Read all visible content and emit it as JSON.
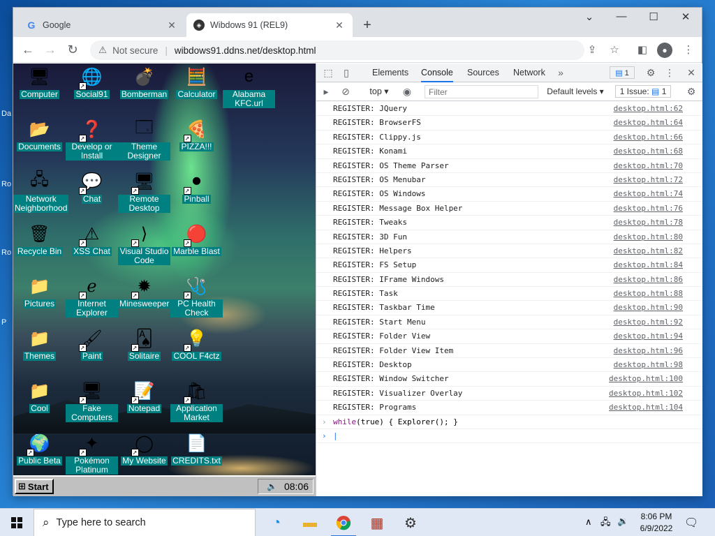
{
  "windows_bg": {
    "side_labels": [
      "Da",
      "Ro",
      "Ro",
      "P"
    ]
  },
  "browser": {
    "tabs": [
      {
        "title": "Google",
        "active": false,
        "favicon": "google-icon"
      },
      {
        "title": "Wibdows 91 (REL9)",
        "active": true,
        "favicon": "wibdows-icon"
      }
    ],
    "new_tab_symbol": "+",
    "window_controls": {
      "tab_search": "⌄",
      "minimize": "—",
      "maximize": "☐",
      "close": "✕"
    },
    "address": {
      "security_label": "Not secure",
      "url": "wibdows91.ddns.net/desktop.html"
    }
  },
  "desktop": {
    "icons": [
      {
        "label": "Computer",
        "glyph": "🖥"
      },
      {
        "label": "Social91",
        "glyph": "🌐",
        "shortcut": true
      },
      {
        "label": "Bomberman",
        "glyph": "💣"
      },
      {
        "label": "Calculator",
        "glyph": "🧮"
      },
      {
        "label": "Alabama KFC.url",
        "glyph": "e"
      },
      {
        "label": "Documents",
        "glyph": "📂"
      },
      {
        "label": "Develop or Install",
        "glyph": "❓",
        "shortcut": true
      },
      {
        "label": "Theme Designer",
        "glyph": "🗔"
      },
      {
        "label": "PIZZA!!!",
        "glyph": "🍕",
        "shortcut": true
      },
      {
        "label": "Network Neighborhood",
        "glyph": "🖧"
      },
      {
        "label": "Chat",
        "glyph": "💬",
        "shortcut": true
      },
      {
        "label": "Remote Desktop",
        "glyph": "🖥",
        "shortcut": true
      },
      {
        "label": "Pinball",
        "glyph": "⚫",
        "shortcut": true
      },
      {
        "label": "Recycle Bin",
        "glyph": "🗑"
      },
      {
        "label": "XSS Chat",
        "glyph": "⚠",
        "shortcut": true
      },
      {
        "label": "Visual Studio Code",
        "glyph": "⟩",
        "shortcut": true
      },
      {
        "label": "Marble Blast",
        "glyph": "🔴",
        "shortcut": true
      },
      {
        "label": "Pictures",
        "glyph": "📁"
      },
      {
        "label": "Internet Explorer",
        "glyph": "ℯ",
        "shortcut": true
      },
      {
        "label": "Minesweeper",
        "glyph": "✹",
        "shortcut": true
      },
      {
        "label": "PC Health Check",
        "glyph": "🩺",
        "shortcut": true
      },
      {
        "label": "Themes",
        "glyph": "📁"
      },
      {
        "label": "Paint",
        "glyph": "🖌",
        "shortcut": true
      },
      {
        "label": "Solitaire",
        "glyph": "🂡",
        "shortcut": true
      },
      {
        "label": "COOL F4ctz",
        "glyph": "💡",
        "shortcut": true
      },
      {
        "label": "Cool",
        "glyph": "📁"
      },
      {
        "label": "Fake Computers",
        "glyph": "🖥",
        "shortcut": true
      },
      {
        "label": "Notepad",
        "glyph": "📝",
        "shortcut": true
      },
      {
        "label": "Application Market",
        "glyph": "🛍",
        "shortcut": true
      },
      {
        "label": "Public Beta",
        "glyph": "🌍",
        "shortcut": true
      },
      {
        "label": "Pokémon Platinum",
        "glyph": "✦",
        "shortcut": true
      },
      {
        "label": "My Website",
        "glyph": "◯",
        "shortcut": true
      },
      {
        "label": "CREDITS.txt",
        "glyph": "📄"
      }
    ],
    "taskbar": {
      "start_label": "Start",
      "time": "08:06"
    }
  },
  "devtools": {
    "tabs": [
      "Elements",
      "Console",
      "Sources",
      "Network"
    ],
    "active_tab": "Console",
    "more_symbol": "»",
    "issue_badge": "1",
    "context": "top",
    "filter_placeholder": "Filter",
    "levels": "Default levels",
    "issues_label": "1 Issue:",
    "issues_count": "1",
    "logs": [
      {
        "msg": "REGISTER: JQuery",
        "src": "desktop.html:62"
      },
      {
        "msg": "REGISTER: BrowserFS",
        "src": "desktop.html:64"
      },
      {
        "msg": "REGISTER: Clippy.js",
        "src": "desktop.html:66"
      },
      {
        "msg": "REGISTER: Konami",
        "src": "desktop.html:68"
      },
      {
        "msg": "REGISTER: OS Theme Parser",
        "src": "desktop.html:70"
      },
      {
        "msg": "REGISTER: OS Menubar",
        "src": "desktop.html:72"
      },
      {
        "msg": "REGISTER: OS Windows",
        "src": "desktop.html:74"
      },
      {
        "msg": "REGISTER: Message Box Helper",
        "src": "desktop.html:76"
      },
      {
        "msg": "REGISTER: Tweaks",
        "src": "desktop.html:78"
      },
      {
        "msg": "REGISTER: 3D Fun",
        "src": "desktop.html:80"
      },
      {
        "msg": "REGISTER: Helpers",
        "src": "desktop.html:82"
      },
      {
        "msg": "REGISTER: FS Setup",
        "src": "desktop.html:84"
      },
      {
        "msg": "REGISTER: IFrame Windows",
        "src": "desktop.html:86"
      },
      {
        "msg": "REGISTER: Task",
        "src": "desktop.html:88"
      },
      {
        "msg": "REGISTER: Taskbar Time",
        "src": "desktop.html:90"
      },
      {
        "msg": "REGISTER: Start Menu",
        "src": "desktop.html:92"
      },
      {
        "msg": "REGISTER: Folder View",
        "src": "desktop.html:94"
      },
      {
        "msg": "REGISTER: Folder View Item",
        "src": "desktop.html:96"
      },
      {
        "msg": "REGISTER: Desktop",
        "src": "desktop.html:98"
      },
      {
        "msg": "REGISTER: Window Switcher",
        "src": "desktop.html:100"
      },
      {
        "msg": "REGISTER: Visualizer Overlay",
        "src": "desktop.html:102"
      },
      {
        "msg": "REGISTER: Programs",
        "src": "desktop.html:104"
      }
    ],
    "command": {
      "keyword": "while",
      "rest": "(true) { Explorer(); }"
    }
  },
  "win_taskbar": {
    "search_placeholder": "Type here to search",
    "apps": [
      "edge-icon",
      "file-explorer-icon",
      "chrome-icon",
      "winrar-icon",
      "settings-icon"
    ],
    "time": "8:06 PM",
    "date": "6/9/2022"
  }
}
